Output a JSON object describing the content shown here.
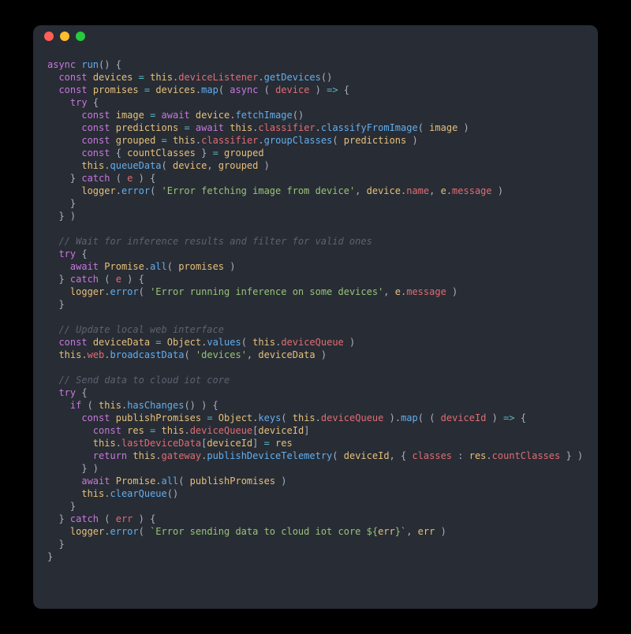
{
  "window": {
    "traffic_lights": [
      "close",
      "minimize",
      "zoom"
    ]
  },
  "code": {
    "lines": [
      [
        [
          "kw",
          "async"
        ],
        [
          "pn",
          " "
        ],
        [
          "fn",
          "run"
        ],
        [
          "pn",
          "() {"
        ]
      ],
      [
        [
          "pn",
          "  "
        ],
        [
          "kw",
          "const"
        ],
        [
          "pn",
          " "
        ],
        [
          "id",
          "devices"
        ],
        [
          "pn",
          " "
        ],
        [
          "op",
          "="
        ],
        [
          "pn",
          " "
        ],
        [
          "thiskw",
          "this"
        ],
        [
          "pn",
          "."
        ],
        [
          "prop",
          "deviceListener"
        ],
        [
          "pn",
          "."
        ],
        [
          "fn",
          "getDevices"
        ],
        [
          "pn",
          "()"
        ]
      ],
      [
        [
          "pn",
          "  "
        ],
        [
          "kw",
          "const"
        ],
        [
          "pn",
          " "
        ],
        [
          "id",
          "promises"
        ],
        [
          "pn",
          " "
        ],
        [
          "op",
          "="
        ],
        [
          "pn",
          " "
        ],
        [
          "id",
          "devices"
        ],
        [
          "pn",
          "."
        ],
        [
          "fn",
          "map"
        ],
        [
          "pn",
          "( "
        ],
        [
          "kw",
          "async"
        ],
        [
          "pn",
          " ( "
        ],
        [
          "param",
          "device"
        ],
        [
          "pn",
          " ) "
        ],
        [
          "op",
          "=>"
        ],
        [
          "pn",
          " {"
        ]
      ],
      [
        [
          "pn",
          "    "
        ],
        [
          "kw",
          "try"
        ],
        [
          "pn",
          " {"
        ]
      ],
      [
        [
          "pn",
          "      "
        ],
        [
          "kw",
          "const"
        ],
        [
          "pn",
          " "
        ],
        [
          "id",
          "image"
        ],
        [
          "pn",
          " "
        ],
        [
          "op",
          "="
        ],
        [
          "pn",
          " "
        ],
        [
          "kw",
          "await"
        ],
        [
          "pn",
          " "
        ],
        [
          "id",
          "device"
        ],
        [
          "pn",
          "."
        ],
        [
          "fn",
          "fetchImage"
        ],
        [
          "pn",
          "()"
        ]
      ],
      [
        [
          "pn",
          "      "
        ],
        [
          "kw",
          "const"
        ],
        [
          "pn",
          " "
        ],
        [
          "id",
          "predictions"
        ],
        [
          "pn",
          " "
        ],
        [
          "op",
          "="
        ],
        [
          "pn",
          " "
        ],
        [
          "kw",
          "await"
        ],
        [
          "pn",
          " "
        ],
        [
          "thiskw",
          "this"
        ],
        [
          "pn",
          "."
        ],
        [
          "prop",
          "classifier"
        ],
        [
          "pn",
          "."
        ],
        [
          "fn",
          "classifyFromImage"
        ],
        [
          "pn",
          "( "
        ],
        [
          "id",
          "image"
        ],
        [
          "pn",
          " )"
        ]
      ],
      [
        [
          "pn",
          "      "
        ],
        [
          "kw",
          "const"
        ],
        [
          "pn",
          " "
        ],
        [
          "id",
          "grouped"
        ],
        [
          "pn",
          " "
        ],
        [
          "op",
          "="
        ],
        [
          "pn",
          " "
        ],
        [
          "thiskw",
          "this"
        ],
        [
          "pn",
          "."
        ],
        [
          "prop",
          "classifier"
        ],
        [
          "pn",
          "."
        ],
        [
          "fn",
          "groupClasses"
        ],
        [
          "pn",
          "( "
        ],
        [
          "id",
          "predictions"
        ],
        [
          "pn",
          " )"
        ]
      ],
      [
        [
          "pn",
          "      "
        ],
        [
          "kw",
          "const"
        ],
        [
          "pn",
          " { "
        ],
        [
          "id",
          "countClasses"
        ],
        [
          "pn",
          " } "
        ],
        [
          "op",
          "="
        ],
        [
          "pn",
          " "
        ],
        [
          "id",
          "grouped"
        ]
      ],
      [
        [
          "pn",
          "      "
        ],
        [
          "thiskw",
          "this"
        ],
        [
          "pn",
          "."
        ],
        [
          "fn",
          "queueData"
        ],
        [
          "pn",
          "( "
        ],
        [
          "id",
          "device"
        ],
        [
          "pn",
          ", "
        ],
        [
          "id",
          "grouped"
        ],
        [
          "pn",
          " )"
        ]
      ],
      [
        [
          "pn",
          "    } "
        ],
        [
          "kw",
          "catch"
        ],
        [
          "pn",
          " ( "
        ],
        [
          "param",
          "e"
        ],
        [
          "pn",
          " ) {"
        ]
      ],
      [
        [
          "pn",
          "      "
        ],
        [
          "id",
          "logger"
        ],
        [
          "pn",
          "."
        ],
        [
          "fn",
          "error"
        ],
        [
          "pn",
          "( "
        ],
        [
          "str",
          "'Error fetching image from device'"
        ],
        [
          "pn",
          ", "
        ],
        [
          "id",
          "device"
        ],
        [
          "pn",
          "."
        ],
        [
          "prop",
          "name"
        ],
        [
          "pn",
          ", "
        ],
        [
          "id",
          "e"
        ],
        [
          "pn",
          "."
        ],
        [
          "prop",
          "message"
        ],
        [
          "pn",
          " )"
        ]
      ],
      [
        [
          "pn",
          "    }"
        ]
      ],
      [
        [
          "pn",
          "  } )"
        ]
      ],
      [
        [
          "pn",
          ""
        ]
      ],
      [
        [
          "pn",
          "  "
        ],
        [
          "cm",
          "// Wait for inference results and filter for valid ones"
        ]
      ],
      [
        [
          "pn",
          "  "
        ],
        [
          "kw",
          "try"
        ],
        [
          "pn",
          " {"
        ]
      ],
      [
        [
          "pn",
          "    "
        ],
        [
          "kw",
          "await"
        ],
        [
          "pn",
          " "
        ],
        [
          "id",
          "Promise"
        ],
        [
          "pn",
          "."
        ],
        [
          "fn",
          "all"
        ],
        [
          "pn",
          "( "
        ],
        [
          "id",
          "promises"
        ],
        [
          "pn",
          " )"
        ]
      ],
      [
        [
          "pn",
          "  } "
        ],
        [
          "kw",
          "catch"
        ],
        [
          "pn",
          " ( "
        ],
        [
          "param",
          "e"
        ],
        [
          "pn",
          " ) {"
        ]
      ],
      [
        [
          "pn",
          "    "
        ],
        [
          "id",
          "logger"
        ],
        [
          "pn",
          "."
        ],
        [
          "fn",
          "error"
        ],
        [
          "pn",
          "( "
        ],
        [
          "str",
          "'Error running inference on some devices'"
        ],
        [
          "pn",
          ", "
        ],
        [
          "id",
          "e"
        ],
        [
          "pn",
          "."
        ],
        [
          "prop",
          "message"
        ],
        [
          "pn",
          " )"
        ]
      ],
      [
        [
          "pn",
          "  }"
        ]
      ],
      [
        [
          "pn",
          ""
        ]
      ],
      [
        [
          "pn",
          "  "
        ],
        [
          "cm",
          "// Update local web interface"
        ]
      ],
      [
        [
          "pn",
          "  "
        ],
        [
          "kw",
          "const"
        ],
        [
          "pn",
          " "
        ],
        [
          "id",
          "deviceData"
        ],
        [
          "pn",
          " "
        ],
        [
          "op",
          "="
        ],
        [
          "pn",
          " "
        ],
        [
          "id",
          "Object"
        ],
        [
          "pn",
          "."
        ],
        [
          "fn",
          "values"
        ],
        [
          "pn",
          "( "
        ],
        [
          "thiskw",
          "this"
        ],
        [
          "pn",
          "."
        ],
        [
          "prop",
          "deviceQueue"
        ],
        [
          "pn",
          " )"
        ]
      ],
      [
        [
          "pn",
          "  "
        ],
        [
          "thiskw",
          "this"
        ],
        [
          "pn",
          "."
        ],
        [
          "prop",
          "web"
        ],
        [
          "pn",
          "."
        ],
        [
          "fn",
          "broadcastData"
        ],
        [
          "pn",
          "( "
        ],
        [
          "str",
          "'devices'"
        ],
        [
          "pn",
          ", "
        ],
        [
          "id",
          "deviceData"
        ],
        [
          "pn",
          " )"
        ]
      ],
      [
        [
          "pn",
          ""
        ]
      ],
      [
        [
          "pn",
          "  "
        ],
        [
          "cm",
          "// Send data to cloud iot core"
        ]
      ],
      [
        [
          "pn",
          "  "
        ],
        [
          "kw",
          "try"
        ],
        [
          "pn",
          " {"
        ]
      ],
      [
        [
          "pn",
          "    "
        ],
        [
          "kw",
          "if"
        ],
        [
          "pn",
          " ( "
        ],
        [
          "thiskw",
          "this"
        ],
        [
          "pn",
          "."
        ],
        [
          "fn",
          "hasChanges"
        ],
        [
          "pn",
          "() ) {"
        ]
      ],
      [
        [
          "pn",
          "      "
        ],
        [
          "kw",
          "const"
        ],
        [
          "pn",
          " "
        ],
        [
          "id",
          "publishPromises"
        ],
        [
          "pn",
          " "
        ],
        [
          "op",
          "="
        ],
        [
          "pn",
          " "
        ],
        [
          "id",
          "Object"
        ],
        [
          "pn",
          "."
        ],
        [
          "fn",
          "keys"
        ],
        [
          "pn",
          "( "
        ],
        [
          "thiskw",
          "this"
        ],
        [
          "pn",
          "."
        ],
        [
          "prop",
          "deviceQueue"
        ],
        [
          "pn",
          " )."
        ],
        [
          "fn",
          "map"
        ],
        [
          "pn",
          "( ( "
        ],
        [
          "param",
          "deviceId"
        ],
        [
          "pn",
          " ) "
        ],
        [
          "op",
          "=>"
        ],
        [
          "pn",
          " {"
        ]
      ],
      [
        [
          "pn",
          "        "
        ],
        [
          "kw",
          "const"
        ],
        [
          "pn",
          " "
        ],
        [
          "id",
          "res"
        ],
        [
          "pn",
          " "
        ],
        [
          "op",
          "="
        ],
        [
          "pn",
          " "
        ],
        [
          "thiskw",
          "this"
        ],
        [
          "pn",
          "."
        ],
        [
          "prop",
          "deviceQueue"
        ],
        [
          "pn",
          "["
        ],
        [
          "id",
          "deviceId"
        ],
        [
          "pn",
          "]"
        ]
      ],
      [
        [
          "pn",
          "        "
        ],
        [
          "thiskw",
          "this"
        ],
        [
          "pn",
          "."
        ],
        [
          "prop",
          "lastDeviceData"
        ],
        [
          "pn",
          "["
        ],
        [
          "id",
          "deviceId"
        ],
        [
          "pn",
          "] "
        ],
        [
          "op",
          "="
        ],
        [
          "pn",
          " "
        ],
        [
          "id",
          "res"
        ]
      ],
      [
        [
          "pn",
          "        "
        ],
        [
          "kw",
          "return"
        ],
        [
          "pn",
          " "
        ],
        [
          "thiskw",
          "this"
        ],
        [
          "pn",
          "."
        ],
        [
          "prop",
          "gateway"
        ],
        [
          "pn",
          "."
        ],
        [
          "fn",
          "publishDeviceTelemetry"
        ],
        [
          "pn",
          "( "
        ],
        [
          "id",
          "deviceId"
        ],
        [
          "pn",
          ", { "
        ],
        [
          "prop",
          "classes"
        ],
        [
          "pn",
          " : "
        ],
        [
          "id",
          "res"
        ],
        [
          "pn",
          "."
        ],
        [
          "prop",
          "countClasses"
        ],
        [
          "pn",
          " } )"
        ]
      ],
      [
        [
          "pn",
          "      } )"
        ]
      ],
      [
        [
          "pn",
          "      "
        ],
        [
          "kw",
          "await"
        ],
        [
          "pn",
          " "
        ],
        [
          "id",
          "Promise"
        ],
        [
          "pn",
          "."
        ],
        [
          "fn",
          "all"
        ],
        [
          "pn",
          "( "
        ],
        [
          "id",
          "publishPromises"
        ],
        [
          "pn",
          " )"
        ]
      ],
      [
        [
          "pn",
          "      "
        ],
        [
          "thiskw",
          "this"
        ],
        [
          "pn",
          "."
        ],
        [
          "fn",
          "clearQueue"
        ],
        [
          "pn",
          "()"
        ]
      ],
      [
        [
          "pn",
          "    }"
        ]
      ],
      [
        [
          "pn",
          "  } "
        ],
        [
          "kw",
          "catch"
        ],
        [
          "pn",
          " ( "
        ],
        [
          "param",
          "err"
        ],
        [
          "pn",
          " ) {"
        ]
      ],
      [
        [
          "pn",
          "    "
        ],
        [
          "id",
          "logger"
        ],
        [
          "pn",
          "."
        ],
        [
          "fn",
          "error"
        ],
        [
          "pn",
          "( "
        ],
        [
          "str",
          "`Error sending data to cloud iot core ${"
        ],
        [
          "id",
          "err"
        ],
        [
          "str",
          "}`"
        ],
        [
          "pn",
          ", "
        ],
        [
          "id",
          "err"
        ],
        [
          "pn",
          " )"
        ]
      ],
      [
        [
          "pn",
          "  }"
        ]
      ],
      [
        [
          "pn",
          "}"
        ]
      ]
    ]
  }
}
